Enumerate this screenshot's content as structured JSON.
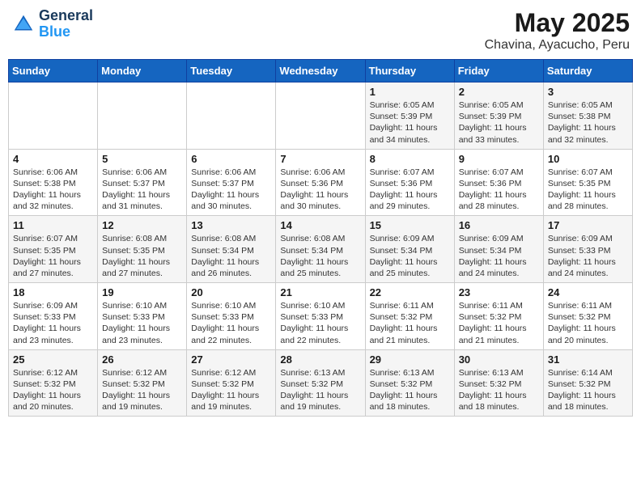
{
  "header": {
    "logo_general": "General",
    "logo_blue": "Blue",
    "month_year": "May 2025",
    "location": "Chavina, Ayacucho, Peru"
  },
  "weekdays": [
    "Sunday",
    "Monday",
    "Tuesday",
    "Wednesday",
    "Thursday",
    "Friday",
    "Saturday"
  ],
  "weeks": [
    [
      {
        "day": "",
        "info": ""
      },
      {
        "day": "",
        "info": ""
      },
      {
        "day": "",
        "info": ""
      },
      {
        "day": "",
        "info": ""
      },
      {
        "day": "1",
        "info": "Sunrise: 6:05 AM\nSunset: 5:39 PM\nDaylight: 11 hours and 34 minutes."
      },
      {
        "day": "2",
        "info": "Sunrise: 6:05 AM\nSunset: 5:39 PM\nDaylight: 11 hours and 33 minutes."
      },
      {
        "day": "3",
        "info": "Sunrise: 6:05 AM\nSunset: 5:38 PM\nDaylight: 11 hours and 32 minutes."
      }
    ],
    [
      {
        "day": "4",
        "info": "Sunrise: 6:06 AM\nSunset: 5:38 PM\nDaylight: 11 hours and 32 minutes."
      },
      {
        "day": "5",
        "info": "Sunrise: 6:06 AM\nSunset: 5:37 PM\nDaylight: 11 hours and 31 minutes."
      },
      {
        "day": "6",
        "info": "Sunrise: 6:06 AM\nSunset: 5:37 PM\nDaylight: 11 hours and 30 minutes."
      },
      {
        "day": "7",
        "info": "Sunrise: 6:06 AM\nSunset: 5:36 PM\nDaylight: 11 hours and 30 minutes."
      },
      {
        "day": "8",
        "info": "Sunrise: 6:07 AM\nSunset: 5:36 PM\nDaylight: 11 hours and 29 minutes."
      },
      {
        "day": "9",
        "info": "Sunrise: 6:07 AM\nSunset: 5:36 PM\nDaylight: 11 hours and 28 minutes."
      },
      {
        "day": "10",
        "info": "Sunrise: 6:07 AM\nSunset: 5:35 PM\nDaylight: 11 hours and 28 minutes."
      }
    ],
    [
      {
        "day": "11",
        "info": "Sunrise: 6:07 AM\nSunset: 5:35 PM\nDaylight: 11 hours and 27 minutes."
      },
      {
        "day": "12",
        "info": "Sunrise: 6:08 AM\nSunset: 5:35 PM\nDaylight: 11 hours and 27 minutes."
      },
      {
        "day": "13",
        "info": "Sunrise: 6:08 AM\nSunset: 5:34 PM\nDaylight: 11 hours and 26 minutes."
      },
      {
        "day": "14",
        "info": "Sunrise: 6:08 AM\nSunset: 5:34 PM\nDaylight: 11 hours and 25 minutes."
      },
      {
        "day": "15",
        "info": "Sunrise: 6:09 AM\nSunset: 5:34 PM\nDaylight: 11 hours and 25 minutes."
      },
      {
        "day": "16",
        "info": "Sunrise: 6:09 AM\nSunset: 5:34 PM\nDaylight: 11 hours and 24 minutes."
      },
      {
        "day": "17",
        "info": "Sunrise: 6:09 AM\nSunset: 5:33 PM\nDaylight: 11 hours and 24 minutes."
      }
    ],
    [
      {
        "day": "18",
        "info": "Sunrise: 6:09 AM\nSunset: 5:33 PM\nDaylight: 11 hours and 23 minutes."
      },
      {
        "day": "19",
        "info": "Sunrise: 6:10 AM\nSunset: 5:33 PM\nDaylight: 11 hours and 23 minutes."
      },
      {
        "day": "20",
        "info": "Sunrise: 6:10 AM\nSunset: 5:33 PM\nDaylight: 11 hours and 22 minutes."
      },
      {
        "day": "21",
        "info": "Sunrise: 6:10 AM\nSunset: 5:33 PM\nDaylight: 11 hours and 22 minutes."
      },
      {
        "day": "22",
        "info": "Sunrise: 6:11 AM\nSunset: 5:32 PM\nDaylight: 11 hours and 21 minutes."
      },
      {
        "day": "23",
        "info": "Sunrise: 6:11 AM\nSunset: 5:32 PM\nDaylight: 11 hours and 21 minutes."
      },
      {
        "day": "24",
        "info": "Sunrise: 6:11 AM\nSunset: 5:32 PM\nDaylight: 11 hours and 20 minutes."
      }
    ],
    [
      {
        "day": "25",
        "info": "Sunrise: 6:12 AM\nSunset: 5:32 PM\nDaylight: 11 hours and 20 minutes."
      },
      {
        "day": "26",
        "info": "Sunrise: 6:12 AM\nSunset: 5:32 PM\nDaylight: 11 hours and 19 minutes."
      },
      {
        "day": "27",
        "info": "Sunrise: 6:12 AM\nSunset: 5:32 PM\nDaylight: 11 hours and 19 minutes."
      },
      {
        "day": "28",
        "info": "Sunrise: 6:13 AM\nSunset: 5:32 PM\nDaylight: 11 hours and 19 minutes."
      },
      {
        "day": "29",
        "info": "Sunrise: 6:13 AM\nSunset: 5:32 PM\nDaylight: 11 hours and 18 minutes."
      },
      {
        "day": "30",
        "info": "Sunrise: 6:13 AM\nSunset: 5:32 PM\nDaylight: 11 hours and 18 minutes."
      },
      {
        "day": "31",
        "info": "Sunrise: 6:14 AM\nSunset: 5:32 PM\nDaylight: 11 hours and 18 minutes."
      }
    ]
  ]
}
